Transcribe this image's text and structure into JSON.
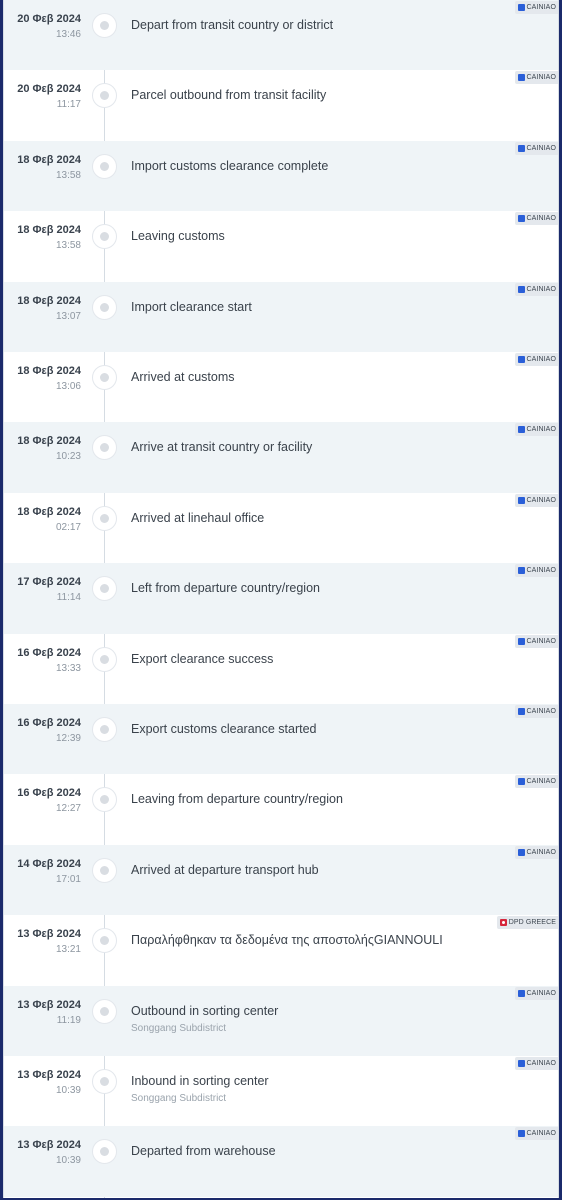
{
  "events": [
    {
      "date": "20 Φεβ 2024",
      "time": "13:46",
      "description": "Depart from transit country or district",
      "location": "",
      "carrier": "CAINIAO",
      "carrier_icon": "cainiao-logo-icon"
    },
    {
      "date": "20 Φεβ 2024",
      "time": "11:17",
      "description": "Parcel outbound from transit facility",
      "location": "",
      "carrier": "CAINIAO",
      "carrier_icon": "cainiao-logo-icon"
    },
    {
      "date": "18 Φεβ 2024",
      "time": "13:58",
      "description": "Import customs clearance complete",
      "location": "",
      "carrier": "CAINIAO",
      "carrier_icon": "cainiao-logo-icon"
    },
    {
      "date": "18 Φεβ 2024",
      "time": "13:58",
      "description": "Leaving customs",
      "location": "",
      "carrier": "CAINIAO",
      "carrier_icon": "cainiao-logo-icon"
    },
    {
      "date": "18 Φεβ 2024",
      "time": "13:07",
      "description": "Import clearance start",
      "location": "",
      "carrier": "CAINIAO",
      "carrier_icon": "cainiao-logo-icon"
    },
    {
      "date": "18 Φεβ 2024",
      "time": "13:06",
      "description": "Arrived at customs",
      "location": "",
      "carrier": "CAINIAO",
      "carrier_icon": "cainiao-logo-icon"
    },
    {
      "date": "18 Φεβ 2024",
      "time": "10:23",
      "description": "Arrive at transit country or facility",
      "location": "",
      "carrier": "CAINIAO",
      "carrier_icon": "cainiao-logo-icon"
    },
    {
      "date": "18 Φεβ 2024",
      "time": "02:17",
      "description": "Arrived at linehaul office",
      "location": "",
      "carrier": "CAINIAO",
      "carrier_icon": "cainiao-logo-icon"
    },
    {
      "date": "17 Φεβ 2024",
      "time": "11:14",
      "description": "Left from departure country/region",
      "location": "",
      "carrier": "CAINIAO",
      "carrier_icon": "cainiao-logo-icon"
    },
    {
      "date": "16 Φεβ 2024",
      "time": "13:33",
      "description": "Export clearance success",
      "location": "",
      "carrier": "CAINIAO",
      "carrier_icon": "cainiao-logo-icon"
    },
    {
      "date": "16 Φεβ 2024",
      "time": "12:39",
      "description": "Export customs clearance started",
      "location": "",
      "carrier": "CAINIAO",
      "carrier_icon": "cainiao-logo-icon"
    },
    {
      "date": "16 Φεβ 2024",
      "time": "12:27",
      "description": "Leaving from departure country/region",
      "location": "",
      "carrier": "CAINIAO",
      "carrier_icon": "cainiao-logo-icon"
    },
    {
      "date": "14 Φεβ 2024",
      "time": "17:01",
      "description": "Arrived at departure transport hub",
      "location": "",
      "carrier": "CAINIAO",
      "carrier_icon": "cainiao-logo-icon"
    },
    {
      "date": "13 Φεβ 2024",
      "time": "13:21",
      "description": "Παραλήφθηκαν τα δεδομένα της αποστολήςGIANNOULI",
      "location": "",
      "carrier": "DPD GREECE",
      "carrier_icon": "dpd-logo-icon"
    },
    {
      "date": "13 Φεβ 2024",
      "time": "11:19",
      "description": "Outbound in sorting center",
      "location": "Songgang Subdistrict",
      "carrier": "CAINIAO",
      "carrier_icon": "cainiao-logo-icon"
    },
    {
      "date": "13 Φεβ 2024",
      "time": "10:39",
      "description": "Inbound in sorting center",
      "location": "Songgang Subdistrict",
      "carrier": "CAINIAO",
      "carrier_icon": "cainiao-logo-icon"
    },
    {
      "date": "13 Φεβ 2024",
      "time": "10:39",
      "description": "Departed from warehouse",
      "location": "",
      "carrier": "CAINIAO",
      "carrier_icon": "cainiao-logo-icon"
    }
  ]
}
